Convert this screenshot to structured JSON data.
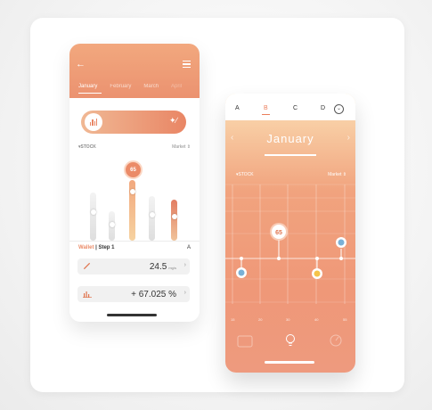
{
  "left_phone": {
    "tabs": [
      {
        "label": "January"
      },
      {
        "label": "February"
      },
      {
        "label": "March"
      },
      {
        "label": "April"
      }
    ],
    "filter_left": "▾STOCK",
    "filter_right": "Market ⇕",
    "selected_value": "65",
    "column_levels": [
      0.68,
      0.41,
      0.85,
      0.62,
      0.58
    ],
    "wallet": {
      "label": "Wallet",
      "separator": " | ",
      "step": "Step 1",
      "right": "A"
    },
    "field1": {
      "value": "24.5",
      "unit": "mg/s",
      "icon": "pencil-icon"
    },
    "field2": {
      "value": "+ 67.025 %",
      "icon": "bar-chart-icon"
    }
  },
  "right_phone": {
    "tabs": [
      "A",
      "B",
      "C",
      "D"
    ],
    "active_tab": "B",
    "month": "January",
    "filter_left": "▾STOCK",
    "filter_right": "Market ⇕",
    "x_ticks": [
      "15",
      "20",
      "30",
      "40",
      "55"
    ],
    "marker_value": "65",
    "bottom_icons": [
      "wallet-icon",
      "lightbulb-icon",
      "gauge-icon"
    ]
  },
  "colors": {
    "accent": "#eb8b68",
    "accent_light": "#f2a87e",
    "peach": "#fbe0b5",
    "blue": "#7ab1d6"
  }
}
